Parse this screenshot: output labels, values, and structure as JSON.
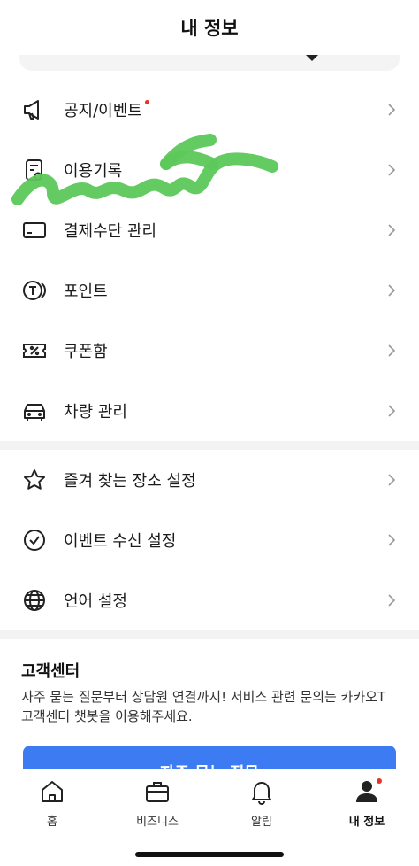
{
  "header": {
    "title": "내 정보"
  },
  "menu_group1": [
    {
      "label": "공지/이벤트",
      "icon": "megaphone-icon",
      "new_dot": true
    },
    {
      "label": "이용기록",
      "icon": "receipt-icon",
      "new_dot": false
    },
    {
      "label": "결제수단 관리",
      "icon": "credit-card-icon",
      "new_dot": false
    },
    {
      "label": "포인트",
      "icon": "point-coin-icon",
      "new_dot": false
    },
    {
      "label": "쿠폰함",
      "icon": "coupon-icon",
      "new_dot": false
    },
    {
      "label": "차량 관리",
      "icon": "car-icon",
      "new_dot": false
    }
  ],
  "menu_group2": [
    {
      "label": "즐겨 찾는 장소 설정",
      "icon": "star-icon"
    },
    {
      "label": "이벤트 수신 설정",
      "icon": "check-circle-icon"
    },
    {
      "label": "언어 설정",
      "icon": "globe-icon"
    }
  ],
  "customer_center": {
    "title": "고객센터",
    "description": "자주 묻는 질문부터 상담원 연결까지! 서비스 관련 문의는 카카오T 고객센터 챗봇을 이용해주세요.",
    "faq_button": "자주 묻는 질문"
  },
  "tabs": [
    {
      "label": "홈",
      "icon": "home-icon",
      "active": false
    },
    {
      "label": "비즈니스",
      "icon": "briefcase-icon",
      "active": false
    },
    {
      "label": "알림",
      "icon": "bell-icon",
      "active": false
    },
    {
      "label": "내 정보",
      "icon": "person-icon",
      "active": true
    }
  ],
  "colors": {
    "accent": "#3d7bf2",
    "badge": "#e8332b",
    "scribble": "#5cc85a"
  }
}
